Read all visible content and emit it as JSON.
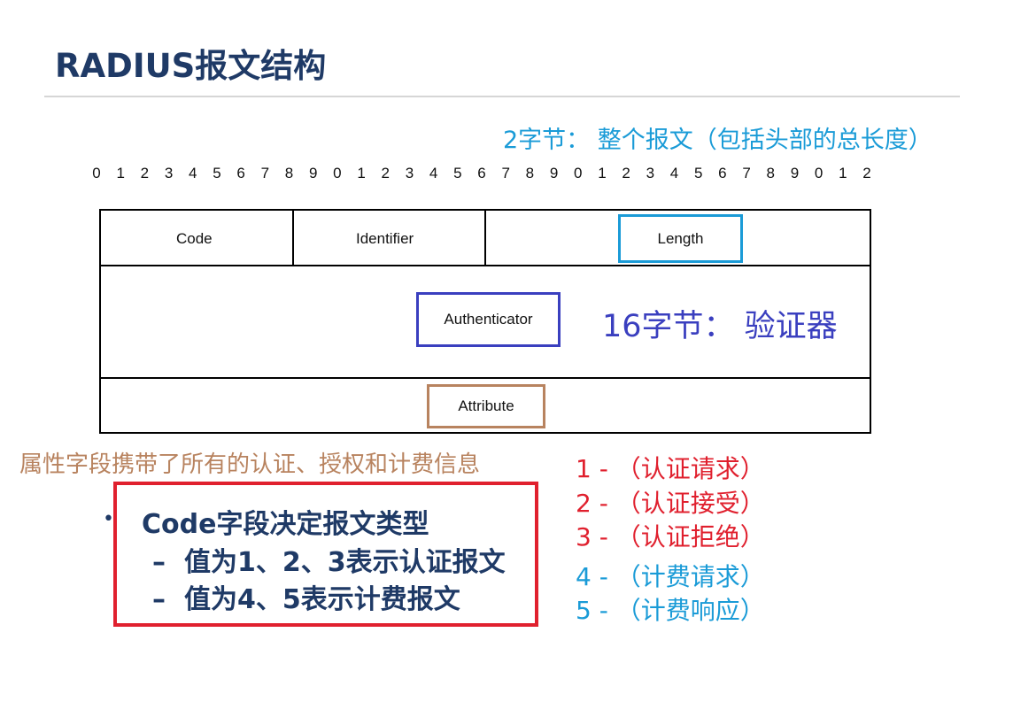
{
  "title": "RADIUS报文结构",
  "length_note": "2字节： 整个报文（包括头部的总长度）",
  "bit_numbers": [
    "0",
    "1",
    "2",
    "3",
    "4",
    "5",
    "6",
    "7",
    "8",
    "9",
    "0",
    "1",
    "2",
    "3",
    "4",
    "5",
    "6",
    "7",
    "8",
    "9",
    "0",
    "1",
    "2",
    "3",
    "4",
    "5",
    "6",
    "7",
    "8",
    "9",
    "0",
    "1",
    "2"
  ],
  "fields": {
    "code": "Code",
    "identifier": "Identifier",
    "length": "Length",
    "authenticator": "Authenticator",
    "attribute": "Attribute"
  },
  "authenticator_note": "16字节： 验证器",
  "attribute_note": "属性字段携带了所有的认证、授权和计费信息",
  "bullet": {
    "main": "Code字段决定报文类型",
    "sub1": "值为1、2、3表示认证报文",
    "sub2": "值为4、5表示计费报文",
    "dash": "–"
  },
  "code_values": [
    {
      "text": "1 - （认证请求）",
      "color": "#e0202e"
    },
    {
      "text": "2 -  （认证接受）",
      "color": "#e0202e"
    },
    {
      "text": "3 - （认证拒绝）",
      "color": "#e0202e"
    },
    {
      "text": "4 -  （计费请求）",
      "color": "#1a9bd7"
    },
    {
      "text": "5 - （计费响应）",
      "color": "#1a9bd7"
    }
  ]
}
